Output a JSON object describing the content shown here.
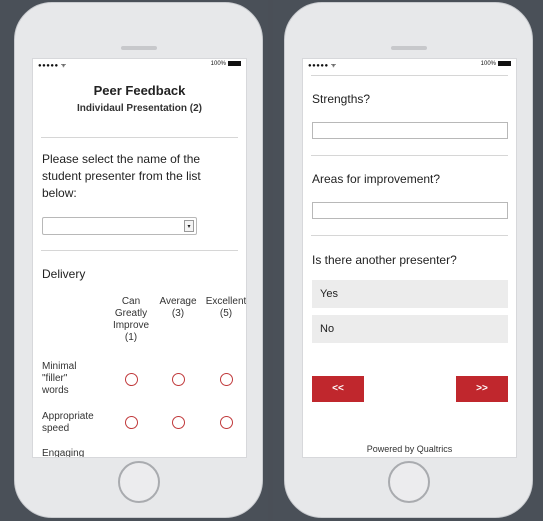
{
  "left_phone": {
    "status_signal": "●●●●● ᯤ",
    "status_battery": "100%",
    "title": "Peer Feedback",
    "subtitle": "Individaul Presentation (2)",
    "question_select": "Please select the name of the student presenter from the list below:",
    "select_arrow": "▾",
    "section_delivery": "Delivery",
    "columns": [
      {
        "l1": "Can",
        "l2": "Greatly",
        "l3": "Improve",
        "l4": "(1)"
      },
      {
        "l1": "",
        "l2": "",
        "l3": "Average",
        "l4": "(3)"
      },
      {
        "l1": "",
        "l2": "",
        "l3": "Excellent",
        "l4": "(5)"
      }
    ],
    "rows": [
      {
        "l1": "Minimal",
        "l2": "\"filler\"",
        "l3": "words"
      },
      {
        "l1": "Appropriate",
        "l2": "speed",
        "l3": ""
      },
      {
        "l1": "Engaging",
        "l2": "",
        "l3": ""
      }
    ]
  },
  "right_phone": {
    "status_signal": "●●●●● ᯤ",
    "status_battery": "100%",
    "q_strengths": "Strengths?",
    "q_improvement": "Areas for improvement?",
    "q_another": "Is there another presenter?",
    "choices": [
      "Yes",
      "No"
    ],
    "back_label": "<<",
    "next_label": ">>",
    "powered_by": "Powered by Qualtrics"
  },
  "colors": {
    "accent": "#c0272d",
    "frame": "#4a5058"
  }
}
